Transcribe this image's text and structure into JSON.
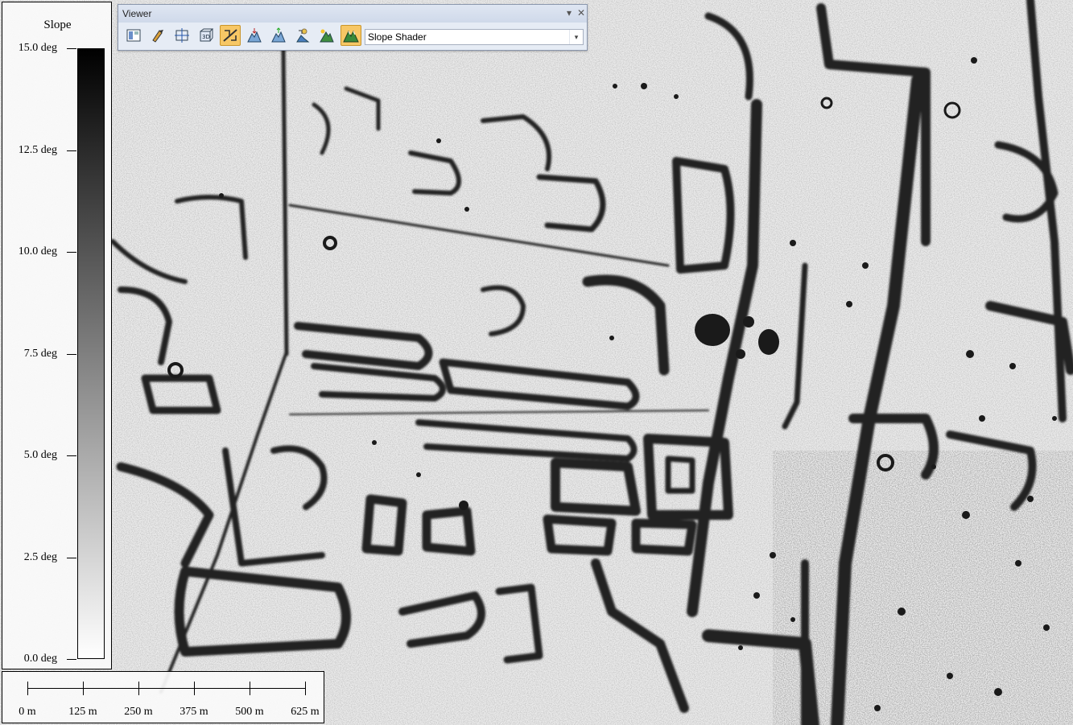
{
  "viewer": {
    "title": "Viewer",
    "close_glyph": "✕",
    "pin_glyph": "▾",
    "shader_selected": "Slope Shader",
    "toolbar_icons": [
      "layout-icon",
      "pick-tool-icon",
      "crosshair-icon",
      "3d-view-icon",
      "slope-shader-icon",
      "elevation-down-icon",
      "elevation-up-icon",
      "light-source-icon",
      "sun-shade-icon",
      "mountain-shade-icon"
    ],
    "active_tools": [
      "slope-shader-icon",
      "mountain-shade-icon"
    ]
  },
  "legend": {
    "title": "Slope",
    "ticks": [
      "15.0 deg",
      "12.5 deg",
      "10.0 deg",
      "7.5 deg",
      "5.0 deg",
      "2.5 deg",
      "0.0 deg"
    ],
    "ramp_top_color": "#000000",
    "ramp_bottom_color": "#ffffff"
  },
  "scale_bar": {
    "labels": [
      "0 m",
      "125 m",
      "250 m",
      "375 m",
      "500 m",
      "625 m"
    ]
  },
  "colors": {
    "toolbar_bg": "#e6ecf5",
    "active_tool": "#f7c765"
  }
}
